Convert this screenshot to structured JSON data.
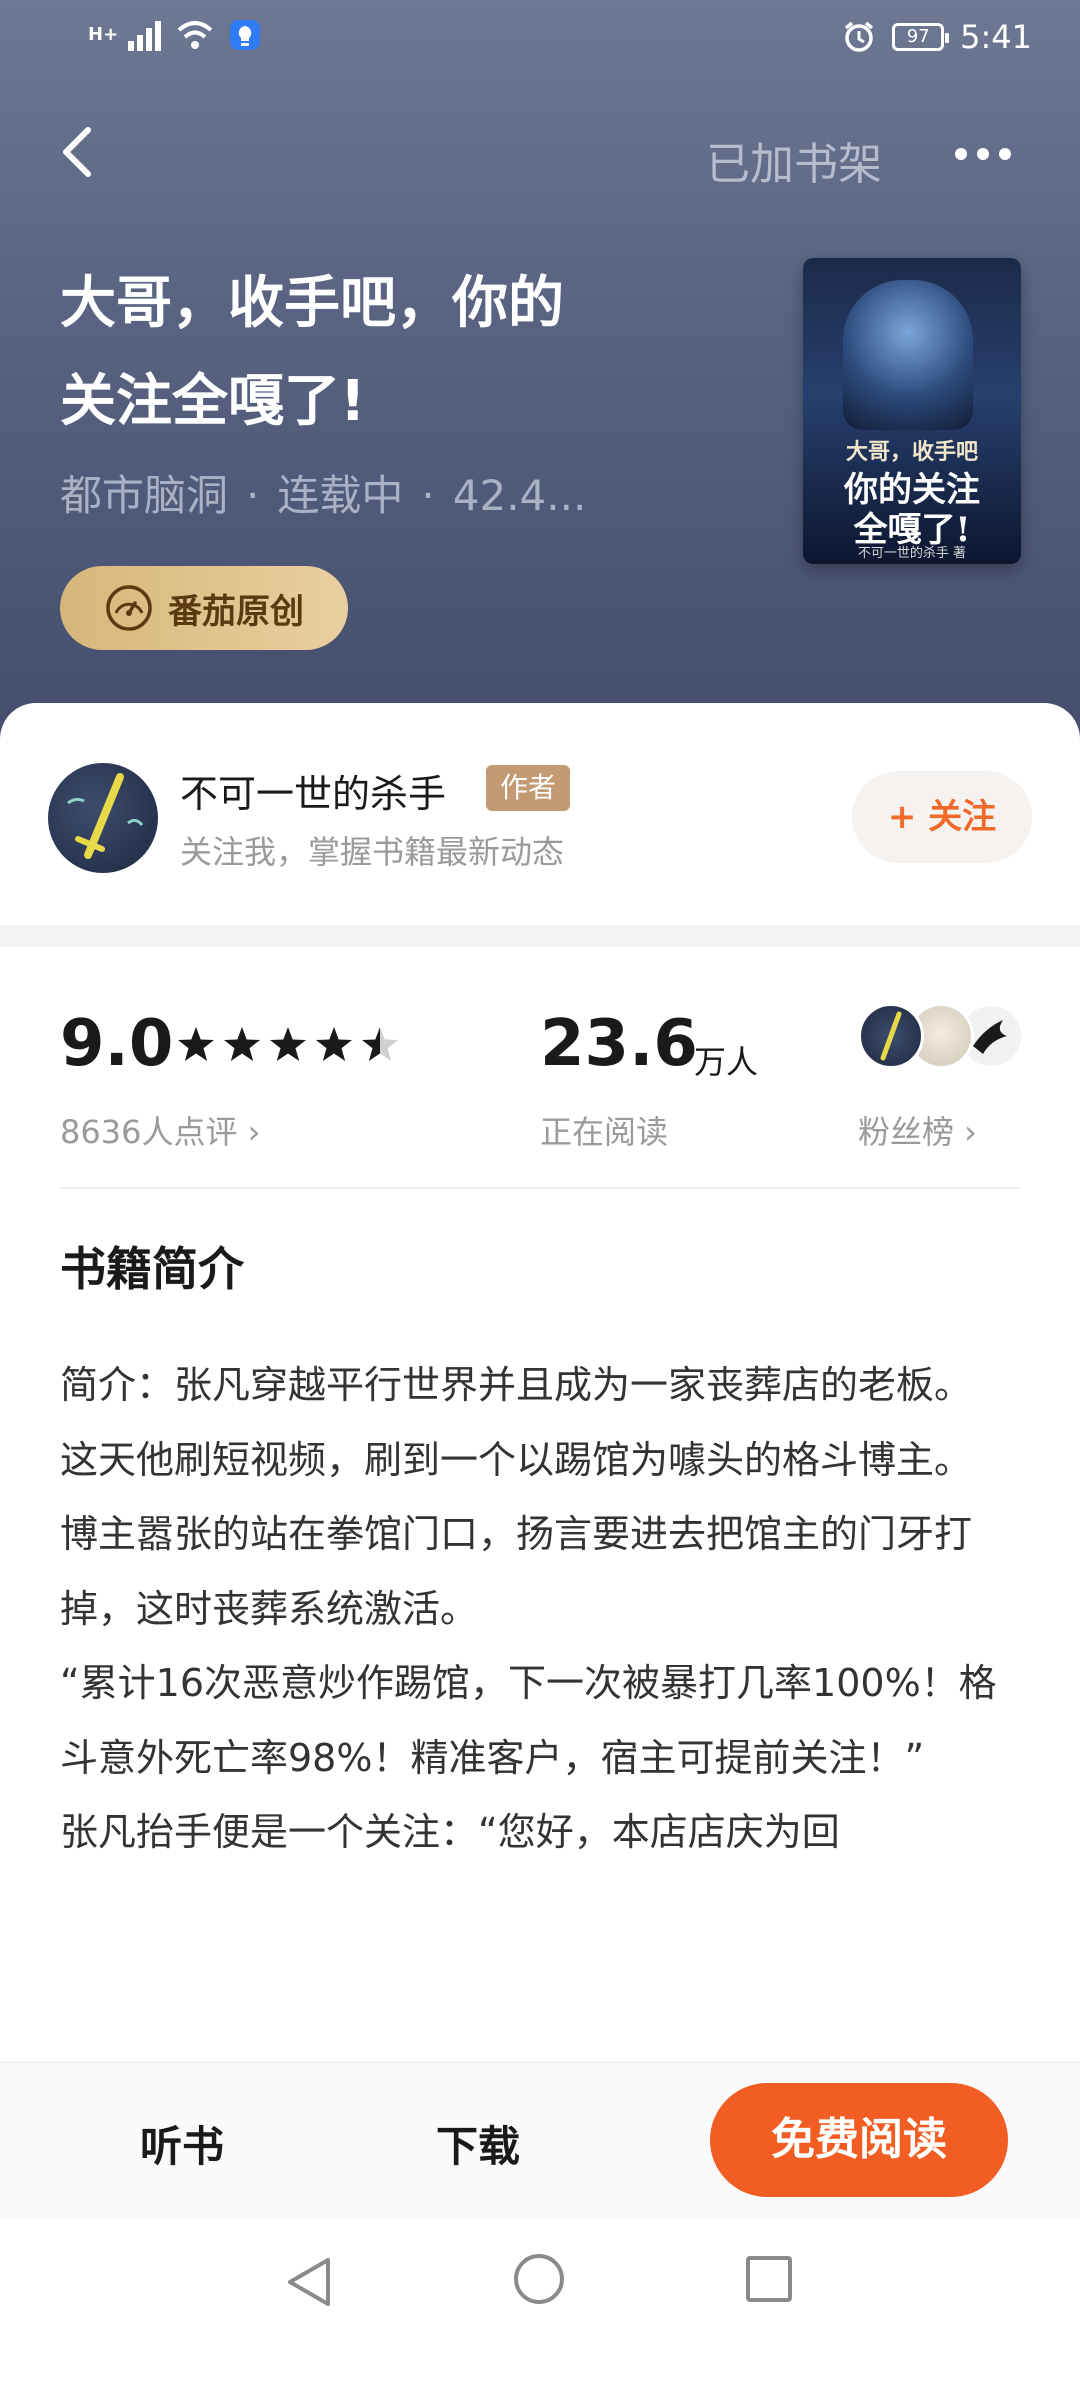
{
  "status_bar": {
    "network": "H+",
    "battery": "97",
    "time": "5:41",
    "icons": [
      "signal-icon",
      "wifi-icon",
      "vpn-icon",
      "alarm-icon",
      "battery-icon"
    ]
  },
  "header": {
    "back_icon": "back-arrow-icon",
    "shelf_status": "已加书架",
    "more_icon": "more-dots-icon"
  },
  "book": {
    "title_line1": "大哥，收手吧，你的",
    "title_line2": "关注全嘎了!",
    "category": "都市脑洞",
    "status": "连载中",
    "word_count": "42.4...",
    "meta_separator": "·",
    "badge": "番茄原创",
    "cover_text": {
      "line1": "大哥，收手吧",
      "line2": "你的关注",
      "line3": "全嘎了!",
      "author": "不可一世的杀手 著"
    }
  },
  "author": {
    "name": "不可一世的杀手",
    "tag": "作者",
    "subtitle": "关注我，掌握书籍最新动态",
    "follow_label": "+ 关注"
  },
  "stats": {
    "score": "9.0",
    "star_rating": 4.5,
    "ratings_label": "8636人点评 ›",
    "readers": "23.6",
    "readers_unit": "万人",
    "reading_label": "正在阅读",
    "fans_label": "粉丝榜 ›"
  },
  "intro": {
    "heading": "书籍简介",
    "paragraphs": [
      "简介：张凡穿越平行世界并且成为一家丧葬店的老板。",
      "这天他刷短视频，刷到一个以踢馆为噱头的格斗博主。",
      "博主嚣张的站在拳馆门口，扬言要进去把馆主的门牙打掉，这时丧葬系统激活。",
      "“累计16次恶意炒作踢馆，下一次被暴打几率100%！格斗意外死亡率98%！精准客户，宿主可提前关注！”",
      "张凡抬手便是一个关注：“您好，本店店庆为回"
    ]
  },
  "bottom_bar": {
    "listen": "听书",
    "download": "下载",
    "read": "免费阅读"
  },
  "nav": {
    "back_icon": "nav-back-icon",
    "home_icon": "nav-home-icon",
    "recent_icon": "nav-recent-icon"
  },
  "colors": {
    "accent": "#f25d24",
    "follow_text": "#f06a2a",
    "badge_gold": "#d6b67a",
    "author_tag": "#c49a73",
    "hero_top": "#6e7893",
    "hero_bottom": "#434c6a"
  }
}
